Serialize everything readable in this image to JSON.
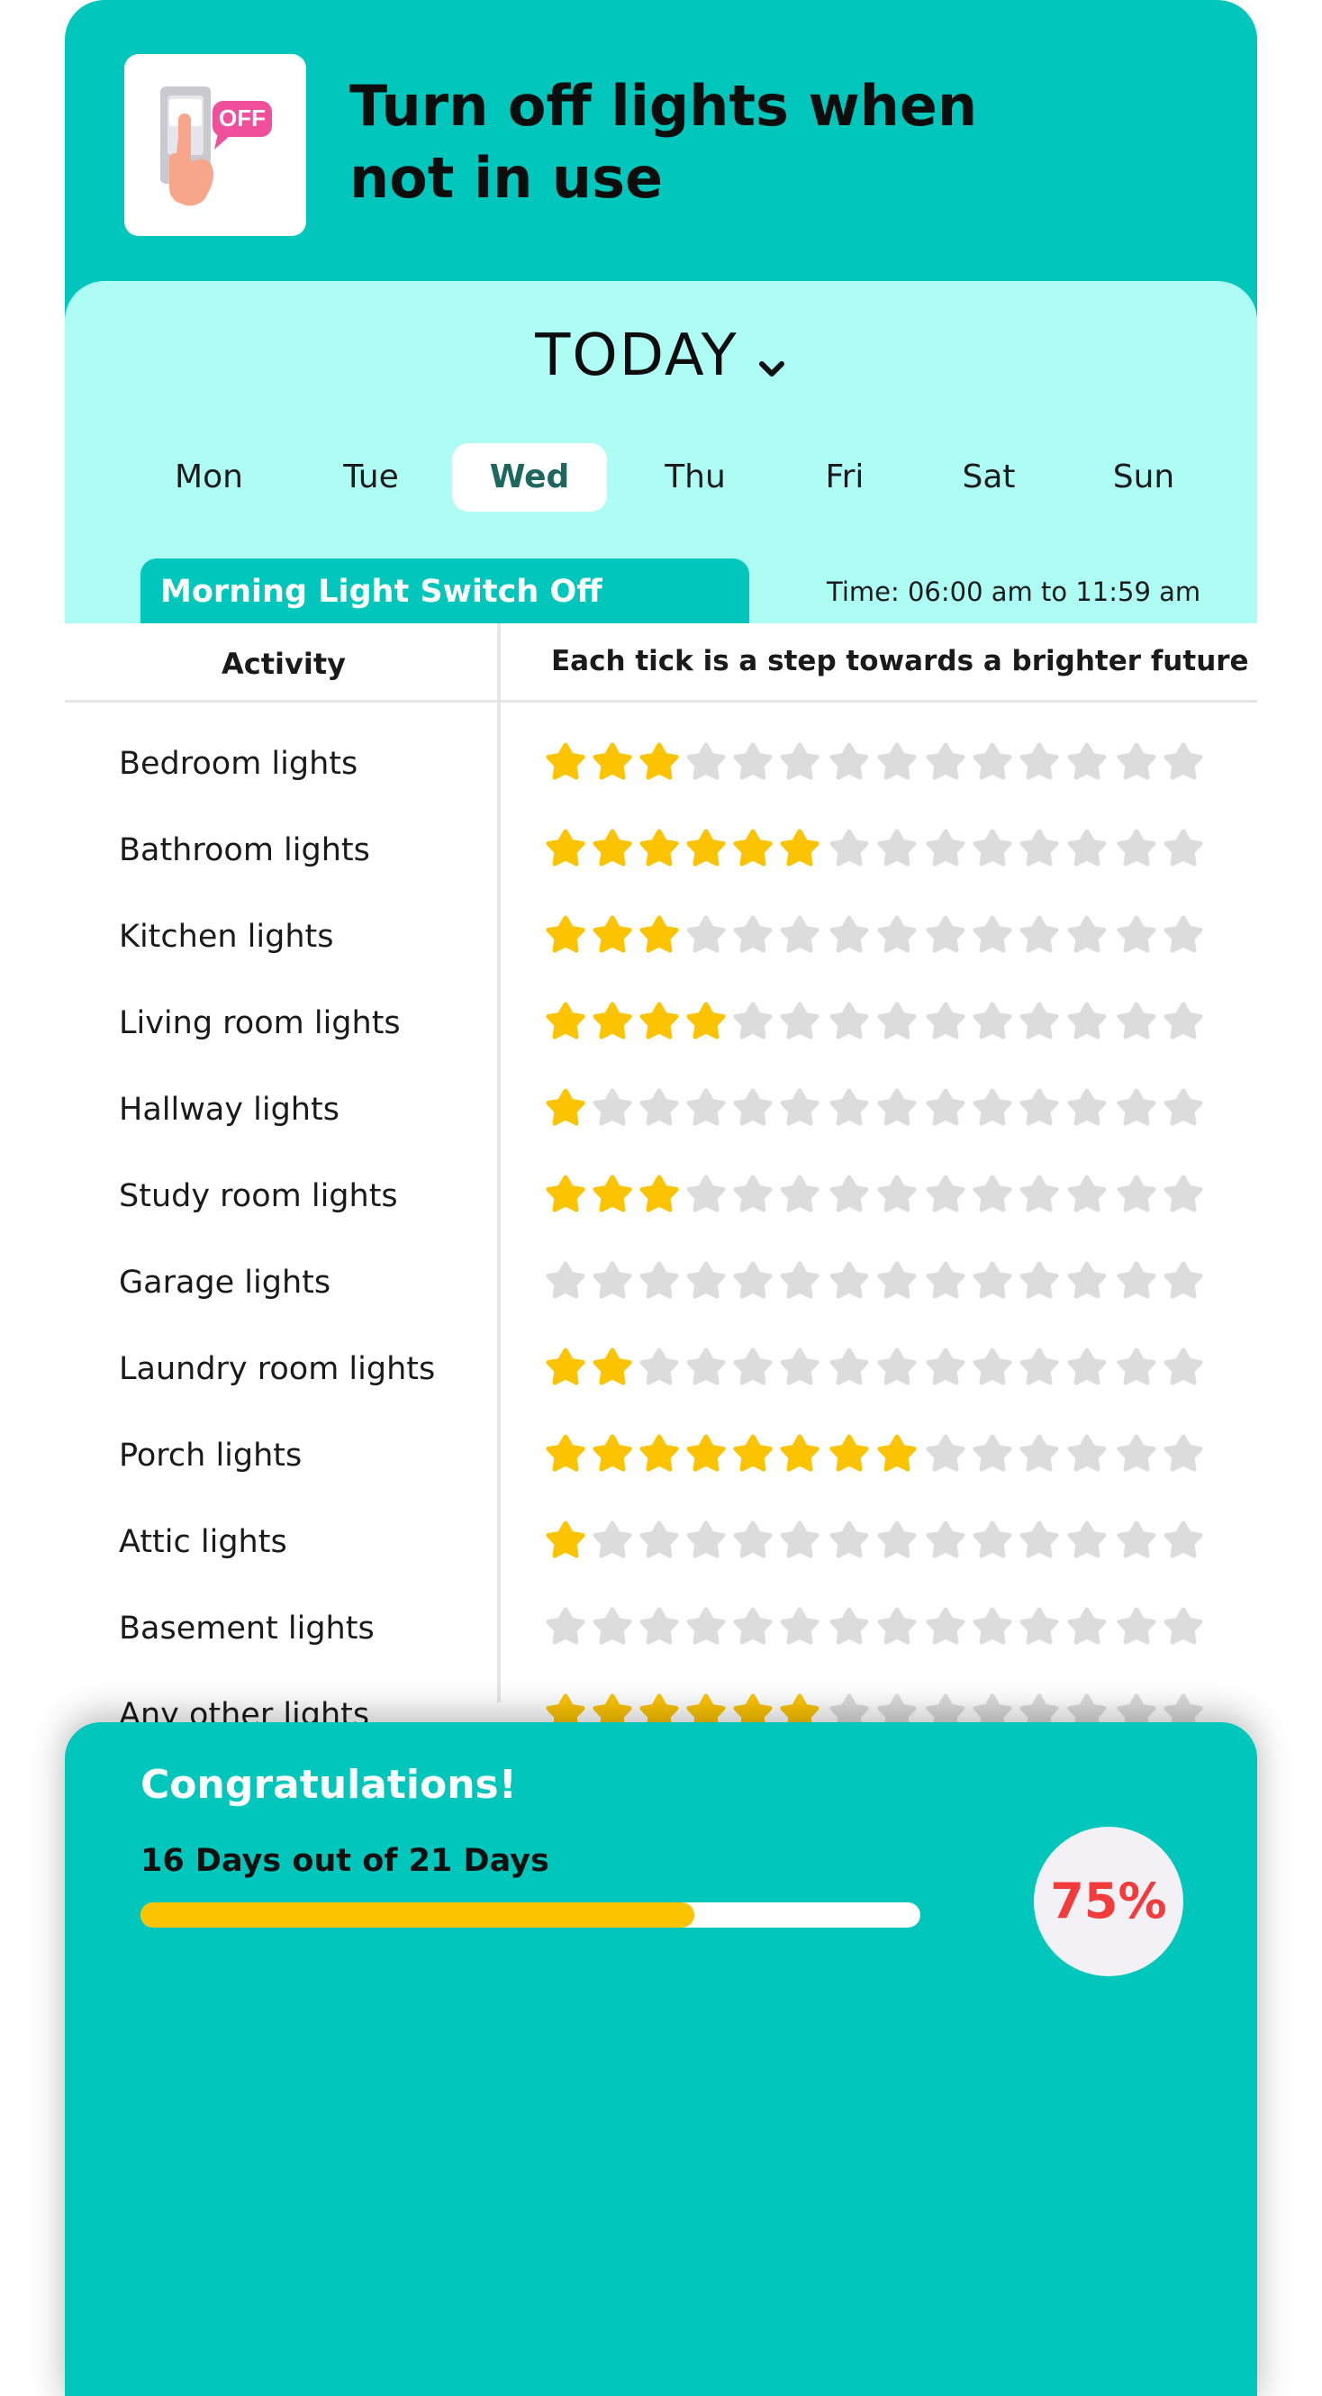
{
  "header": {
    "title": "Turn off lights when not in use",
    "icon": "light-switch-off-icon",
    "icon_badge": "OFF"
  },
  "today": {
    "label": "TODAY",
    "icon": "chevron-down-icon"
  },
  "days": [
    {
      "label": "Mon",
      "active": false
    },
    {
      "label": "Tue",
      "active": false
    },
    {
      "label": "Wed",
      "active": true
    },
    {
      "label": "Thu",
      "active": false
    },
    {
      "label": "Fri",
      "active": false
    },
    {
      "label": "Sat",
      "active": false
    },
    {
      "label": "Sun",
      "active": false
    }
  ],
  "checklist": {
    "title": "Morning Light Switch Off Checklist",
    "time": "Time: 06:00 am to 11:59 am",
    "col_activity": "Activity",
    "col_progress": "Each tick is a step towards a brighter future",
    "stars_total": 14,
    "rows": [
      {
        "label": "Bedroom lights",
        "filled": 3
      },
      {
        "label": "Bathroom lights",
        "filled": 6
      },
      {
        "label": "Kitchen lights",
        "filled": 3
      },
      {
        "label": "Living room lights",
        "filled": 4
      },
      {
        "label": "Hallway lights",
        "filled": 1
      },
      {
        "label": "Study room lights",
        "filled": 3
      },
      {
        "label": "Garage lights",
        "filled": 0
      },
      {
        "label": "Laundry room lights",
        "filled": 2
      },
      {
        "label": "Porch lights",
        "filled": 8
      },
      {
        "label": "Attic lights",
        "filled": 1
      },
      {
        "label": "Basement lights",
        "filled": 0
      },
      {
        "label": "Any other lights",
        "filled": 6
      }
    ]
  },
  "summary": {
    "title": "Congratulations!",
    "days_text": "16 Days out of 21 Days",
    "progress": 0.71,
    "percent": "75%"
  },
  "colors": {
    "teal": "#00c6bc",
    "light_cyan": "#adfdf4",
    "star_on": "#fcc400",
    "star_off": "#dcdcdc",
    "percent": "#f23b3b"
  }
}
